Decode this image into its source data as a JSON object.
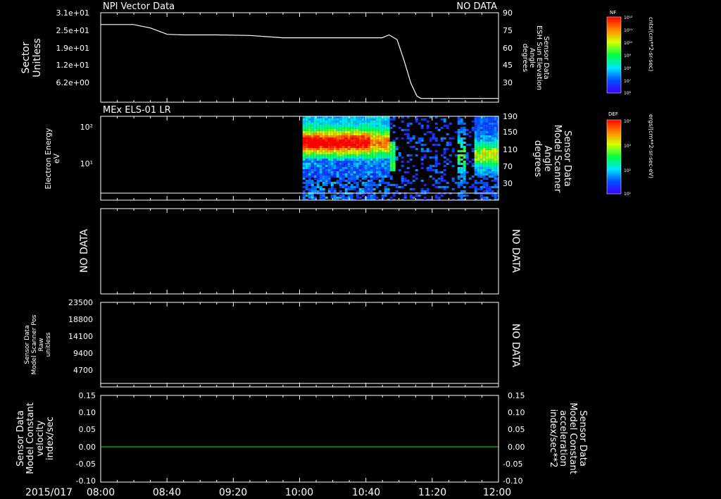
{
  "figure": {
    "background": "#000000",
    "foreground": "#ffffff",
    "accent_green": "#00ff00",
    "date_label": "2015/017",
    "time_ticks": [
      "08:00",
      "08:40",
      "09:20",
      "10:00",
      "10:40",
      "11:20",
      "12:00"
    ],
    "time_range_hours": [
      8.0,
      12.0
    ]
  },
  "panels": [
    {
      "id": "p1",
      "title": "NPI Vector Data",
      "status": "NO DATA",
      "left_label": [
        "Sector",
        "Unitless"
      ],
      "left_ticks": [
        "3.1e+01",
        "2.5e+01",
        "1.9e+01",
        "1.2e+01",
        "6.2e+00"
      ],
      "right_label": [
        "Sensor Data",
        "ESH Sun Elevation",
        "Angle",
        "degrees"
      ],
      "right_ticks": [
        "90",
        "75",
        "60",
        "45",
        "30"
      ],
      "right_ylim": [
        15,
        90
      ],
      "colorbar": {
        "label": "NF",
        "unit": "cnts/(cm**2-sr-sec)",
        "ticks": [
          "10¹²",
          "10¹¹",
          "10¹⁰",
          "10⁹",
          "10⁸",
          "10⁷",
          "10⁶"
        ]
      }
    },
    {
      "id": "p2",
      "title": "MEx ELS-01 LR",
      "left_label": [
        "Electron Energy",
        "eV"
      ],
      "left_ticks": [
        "10²",
        "10¹"
      ],
      "right_label": [
        "Sensor Data",
        "Model Scanner",
        "Angle",
        "degrees"
      ],
      "right_ticks": [
        "190",
        "150",
        "110",
        "70",
        "30"
      ],
      "colorbar": {
        "label": "DEF",
        "unit": "ergs/(cm**2-sr-sec-eV)",
        "ticks": [
          "10⁴",
          "10³",
          "10²",
          "10¹"
        ]
      }
    },
    {
      "id": "p3",
      "left_label": [
        "NO DATA"
      ],
      "right_label": [
        "NO DATA"
      ]
    },
    {
      "id": "p4",
      "left_label": [
        "Sensor Data",
        "Model Scanner Pos",
        "Raw",
        "unitless"
      ],
      "left_ticks": [
        "23500",
        "18800",
        "14100",
        "9400",
        "4700"
      ],
      "right_label": [
        "NO DATA"
      ]
    },
    {
      "id": "p5",
      "left_label": [
        "Sensor Data",
        "Model Constant",
        "velocity",
        "index/sec"
      ],
      "left_ticks": [
        "0.15",
        "0.10",
        "0.05",
        "0.00",
        "-0.05",
        "-0.10"
      ],
      "right_label": [
        "Sensor Data",
        "Model Constant",
        "acceleration",
        "index/sec**2"
      ],
      "right_ticks": [
        "0.15",
        "0.10",
        "0.05",
        "0.00",
        "-0.05",
        "-0.10"
      ]
    }
  ],
  "chart_data": [
    {
      "type": "line",
      "title": "NPI Vector Data",
      "xlabel": "",
      "ylabel": "Angle (degrees)",
      "xlim": [
        8.0,
        12.0
      ],
      "ylim": [
        15,
        90
      ],
      "series": [
        {
          "name": "ESH Sun Elevation",
          "x": [
            8.0,
            8.33,
            8.5,
            8.67,
            8.83,
            9.17,
            9.5,
            9.83,
            10.17,
            10.5,
            10.83,
            10.9,
            10.98,
            11.05,
            11.12,
            11.18,
            11.22,
            11.33,
            12.0
          ],
          "values": [
            81,
            81,
            78,
            72.5,
            72,
            72,
            71.5,
            69.5,
            69.5,
            69.5,
            69.5,
            72,
            68,
            50,
            30,
            19,
            17,
            17,
            17
          ],
          "color": "#ffffff"
        }
      ]
    },
    {
      "type": "heatmap",
      "title": "MEx ELS-01 LR",
      "xlabel": "",
      "ylabel": "Electron Energy (eV)",
      "xlim": [
        8.0,
        12.0
      ],
      "segments": [
        {
          "x": [
            10.03,
            10.88
          ],
          "activity": "high"
        },
        {
          "x": [
            10.88,
            11.5
          ],
          "activity": "sparse"
        },
        {
          "x": [
            11.58,
            11.67
          ],
          "activity": "medium"
        },
        {
          "x": [
            11.73,
            12.0
          ],
          "activity": "medium"
        }
      ],
      "baseline_line": true
    },
    {
      "type": "line",
      "title": "",
      "xlabel": "",
      "ylabel": "velocity (index/sec)",
      "xlim": [
        8.0,
        12.0
      ],
      "ylim": [
        -0.1,
        0.15
      ],
      "series": [
        {
          "name": "Model Constant velocity",
          "x": [
            8.0,
            12.0
          ],
          "values": [
            0.0,
            0.0
          ],
          "color": "#00ff00"
        }
      ]
    }
  ]
}
